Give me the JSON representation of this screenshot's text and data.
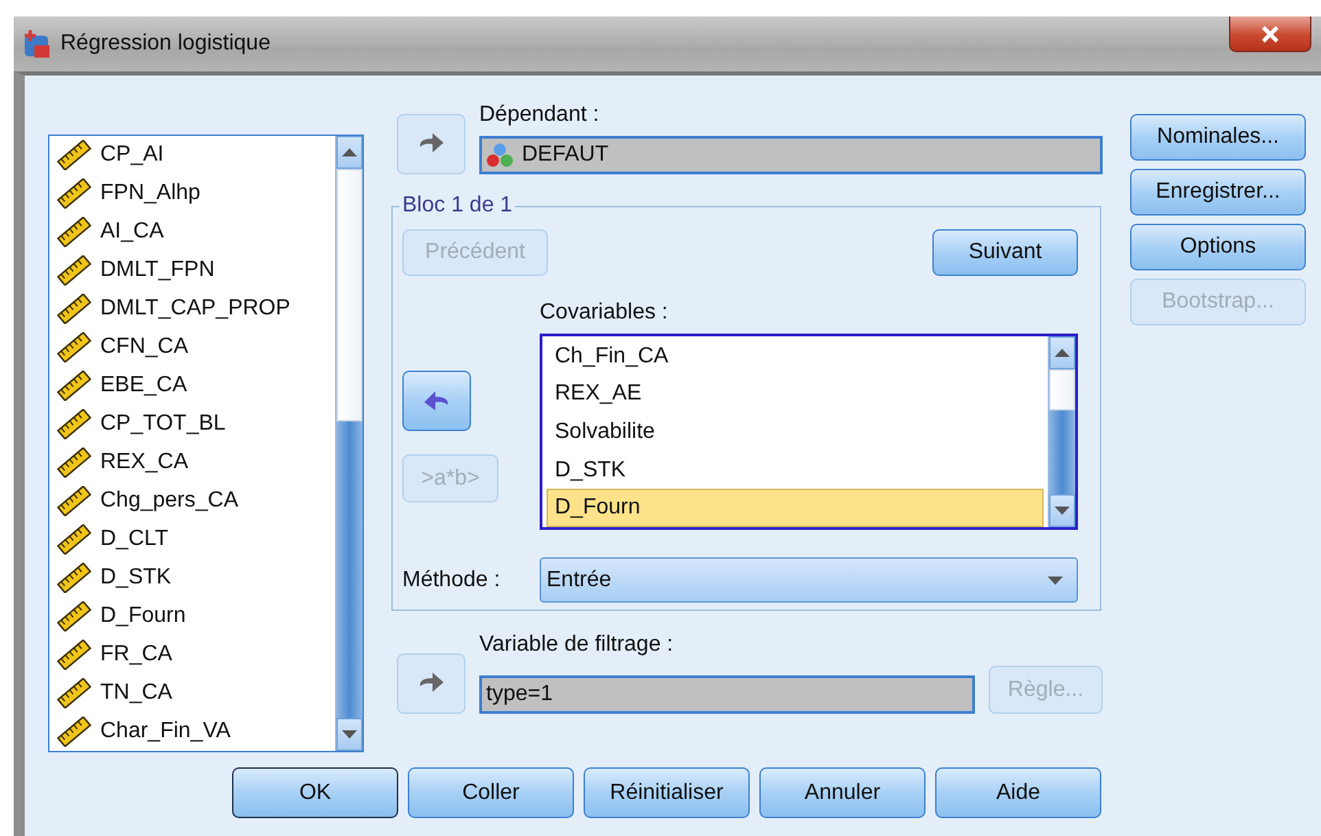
{
  "window": {
    "title": "Régression logistique"
  },
  "variables": [
    {
      "name": "CP_AI"
    },
    {
      "name": "FPN_Alhp"
    },
    {
      "name": "AI_CA"
    },
    {
      "name": "DMLT_FPN"
    },
    {
      "name": "DMLT_CAP_PROP"
    },
    {
      "name": "CFN_CA"
    },
    {
      "name": "EBE_CA"
    },
    {
      "name": "CP_TOT_BL"
    },
    {
      "name": "REX_CA"
    },
    {
      "name": "Chg_pers_CA"
    },
    {
      "name": "D_CLT"
    },
    {
      "name": "D_STK"
    },
    {
      "name": "D_Fourn"
    },
    {
      "name": "FR_CA"
    },
    {
      "name": "TN_CA"
    },
    {
      "name": "Char_Fin_VA"
    }
  ],
  "dependent": {
    "label": "Dépendant :",
    "value": "DEFAUT",
    "move_button": {
      "disabled": true
    }
  },
  "block": {
    "title": "Bloc 1 de 1",
    "previous": {
      "label": "Précédent",
      "disabled": true
    },
    "next": {
      "label": "Suivant",
      "disabled": false
    },
    "covariates_label": "Covariables :",
    "move_button": {
      "disabled": false
    },
    "interaction_button": {
      "label": ">a*b>",
      "disabled": true
    },
    "covariates": [
      {
        "name": "Ch_Fin_CA",
        "selected": false
      },
      {
        "name": "REX_AE",
        "selected": false
      },
      {
        "name": "Solvabilite",
        "selected": false
      },
      {
        "name": "D_STK",
        "selected": false
      },
      {
        "name": "D_Fourn",
        "selected": true
      }
    ],
    "method_label": "Méthode :",
    "method": "Entrée"
  },
  "filter": {
    "label": "Variable de filtrage :",
    "value": "type=1",
    "move_button": {
      "disabled": true
    },
    "rule_button": {
      "label": "Règle...",
      "disabled": true
    }
  },
  "side_buttons": [
    {
      "label": "Nominales...",
      "disabled": false
    },
    {
      "label": "Enregistrer...",
      "disabled": false
    },
    {
      "label": "Options",
      "disabled": false
    },
    {
      "label": "Bootstrap...",
      "disabled": true
    }
  ],
  "buttons": [
    {
      "label": "OK",
      "default": true
    },
    {
      "label": "Coller",
      "default": false
    },
    {
      "label": "Réinitialiser",
      "default": false
    },
    {
      "label": "Annuler",
      "default": false
    },
    {
      "label": "Aide",
      "default": false
    }
  ]
}
